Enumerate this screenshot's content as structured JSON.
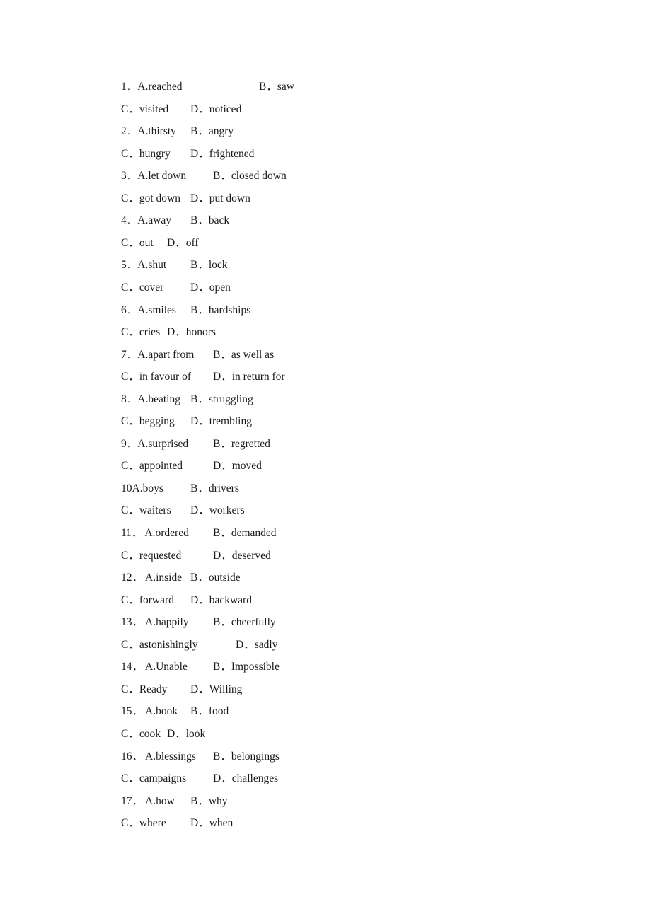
{
  "document": {
    "lines": [
      {
        "segments": [
          "1．A.reached",
          "B．saw"
        ]
      },
      {
        "segments": [
          "C．visited",
          "D．noticed"
        ]
      },
      {
        "segments": [
          "2．A.thirsty",
          "B．angry"
        ]
      },
      {
        "segments": [
          "C．hungry",
          "D．frightened"
        ]
      },
      {
        "segments": [
          "3．A.let down",
          "B．closed down"
        ]
      },
      {
        "segments": [
          "C．got down",
          "D．put down"
        ]
      },
      {
        "segments": [
          "4．A.away",
          "B．back"
        ]
      },
      {
        "segments": [
          "C．out",
          "D．off"
        ]
      },
      {
        "segments": [
          "5．A.shut",
          "B．lock"
        ]
      },
      {
        "segments": [
          "C．cover",
          "D．open"
        ]
      },
      {
        "segments": [
          "6．A.smiles",
          "B．hardships"
        ]
      },
      {
        "segments": [
          "C．cries",
          "D．honors"
        ]
      },
      {
        "segments": [
          "7．A.apart from",
          "B．as well as"
        ]
      },
      {
        "segments": [
          "C．in favour of",
          "D．in return for"
        ]
      },
      {
        "segments": [
          "8．A.beating",
          "B．struggling"
        ]
      },
      {
        "segments": [
          "C．begging",
          "D．trembling"
        ]
      },
      {
        "segments": [
          "9．A.surprised",
          "B．regretted"
        ]
      },
      {
        "segments": [
          "C．appointed",
          "D．moved"
        ]
      },
      {
        "segments": [
          "10A.boys",
          "B．drivers"
        ]
      },
      {
        "segments": [
          "C．waiters",
          "D．workers"
        ]
      },
      {
        "segments": [
          "11． A.ordered",
          "B．demanded"
        ]
      },
      {
        "segments": [
          "C．requested",
          "D．deserved"
        ]
      },
      {
        "segments": [
          "12． A.inside",
          "B．outside"
        ]
      },
      {
        "segments": [
          "C．forward",
          "D．backward"
        ]
      },
      {
        "segments": [
          "13． A.happily",
          "B．cheerfully"
        ]
      },
      {
        "segments": [
          "C．astonishingly",
          "D．sadly"
        ]
      },
      {
        "segments": [
          "14． A.Unable",
          "B．Impossible"
        ]
      },
      {
        "segments": [
          "C．Ready",
          "D．Willing"
        ]
      },
      {
        "segments": [
          "15． A.book",
          "B．food"
        ]
      },
      {
        "segments": [
          "C．cook",
          "D．look"
        ]
      },
      {
        "segments": [
          "16． A.blessings",
          "B．belongings"
        ]
      },
      {
        "segments": [
          "C．campaigns",
          "D．challenges"
        ]
      },
      {
        "segments": [
          "17． A.how",
          "B．why"
        ]
      },
      {
        "segments": [
          "C．where",
          "D．when"
        ]
      }
    ]
  }
}
